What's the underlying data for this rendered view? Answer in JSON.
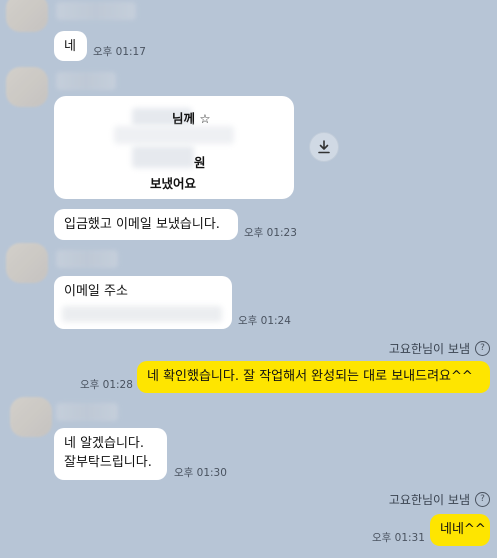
{
  "messages": {
    "m1": {
      "text": "네",
      "time": "오후 01:17"
    },
    "card": {
      "line1": "님께 ☆",
      "line2": "원",
      "line3": "보냈어요"
    },
    "m2": {
      "text": "입금했고 이메일 보냈습니다.",
      "time": "오후 01:23"
    },
    "m3": {
      "text": "이메일 주소",
      "time": "오후 01:24"
    },
    "me1": {
      "sender_note": "고요한님이 보냄",
      "text": "네 확인했습니다. 잘 작업해서 완성되는 대로 보내드려요^^",
      "time": "오후 01:28"
    },
    "m4": {
      "line1": "네 알겠습니다.",
      "line2": "잘부탁드립니다.",
      "time": "오후 01:30"
    },
    "me2": {
      "sender_note": "고요한님이 보냄",
      "text": "네네^^",
      "time": "오후 01:31"
    }
  },
  "icons": {
    "download": "download-icon",
    "help": "question-circle-icon",
    "help_glyph": "?"
  },
  "colors": {
    "background": "#b7c5d6",
    "bubble_other": "#ffffff",
    "bubble_mine": "#fee500"
  }
}
